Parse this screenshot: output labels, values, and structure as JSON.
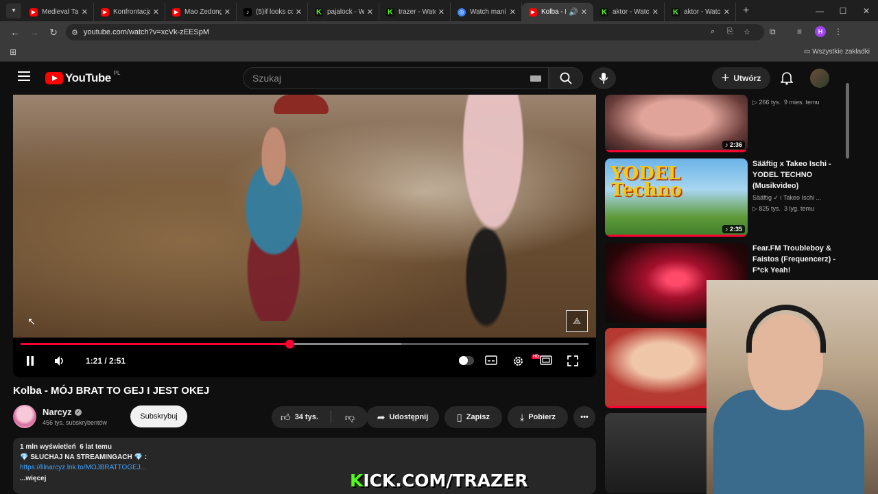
{
  "browser": {
    "tabs": [
      {
        "label": "Medieval Ta",
        "icon": "youtube-icon",
        "active": false
      },
      {
        "label": "Konfrontacja",
        "icon": "youtube-icon",
        "active": false
      },
      {
        "label": "Mao Zedong",
        "icon": "youtube-icon",
        "active": false
      },
      {
        "label": "(5)if looks co",
        "icon": "tiktok-icon",
        "active": false
      },
      {
        "label": "pajalock - W",
        "icon": "kick-icon",
        "active": false
      },
      {
        "label": "trazer - Watc",
        "icon": "kick-icon",
        "active": false
      },
      {
        "label": "Watch mani",
        "icon": "watch-icon",
        "active": false
      },
      {
        "label": "Kolba - M",
        "icon": "youtube-icon",
        "active": true
      },
      {
        "label": "aktor - Watc",
        "icon": "kick-icon",
        "active": false
      },
      {
        "label": "aktor - Watc",
        "icon": "kick-icon",
        "active": false
      }
    ],
    "url": "youtube.com/watch?v=xcVk-zEESpM",
    "profile_initial": "H",
    "bookmarks_label": "Wszystkie zakładki"
  },
  "header": {
    "logo_text": "YouTube",
    "country": "PL",
    "search_placeholder": "Szukaj",
    "create_label": "Utwórz"
  },
  "player": {
    "current_time": "1:21",
    "total_time": "2:51",
    "time_label": "1:21 / 2:51",
    "progress_fraction": 0.4737,
    "buffer_fraction": 0.67,
    "hd_badge": "HD"
  },
  "video": {
    "title": "Kolba - MÓJ BRAT TO GEJ I JEST OKEJ",
    "channel": "Narcyz",
    "subscribers": "456 tys. subskrybentów",
    "subscribe_label": "Subskrybuj",
    "likes": "34 tys.",
    "share_label": "Udostępnij",
    "save_label": "Zapisz",
    "download_label": "Pobierz",
    "views": "1 mln wyświetleń",
    "age": "6 lat temu",
    "stats_line": "1 mln wyświetleń  6 lat temu",
    "desc_line": "💎 SŁUCHAJ NA STREAMINGACH 💎 :",
    "desc_link": "https://lilnarcyz.lnk.to/MOJBRATTOGEJ...",
    "more_label": "...więcej"
  },
  "overlay": {
    "kick_prefix": "K",
    "kick_rest": "ICK.COM/TRAZER"
  },
  "related": [
    {
      "title": "",
      "channel": "",
      "meta": "266 tys.  9 mies. temu",
      "duration": "2:36",
      "progress": 1.0
    },
    {
      "title": "Sääftig x Takeo Ischi - YODEL TECHNO (Musikvideo)",
      "channel": "Sääftig",
      "channel_extra": "i Takeo Ischi ...",
      "meta": "825 tys.  3 lyg. temu",
      "duration": "2:35",
      "progress": 1.0,
      "thumb_text": "YODEL Techno"
    },
    {
      "title": "Fear.FM Troubleboy & Faistos (Frequencerz) - F*ck Yeah!",
      "channel": "",
      "meta": "",
      "duration": "",
      "progress": 0
    },
    {
      "title": "",
      "channel": "",
      "meta": "",
      "duration": "",
      "progress": 1.0
    },
    {
      "title": "",
      "channel": "",
      "meta": "",
      "duration": "",
      "progress": 0
    }
  ],
  "colors": {
    "accent": "#ff0033",
    "kick": "#53fc18",
    "link": "#3ea6ff"
  }
}
